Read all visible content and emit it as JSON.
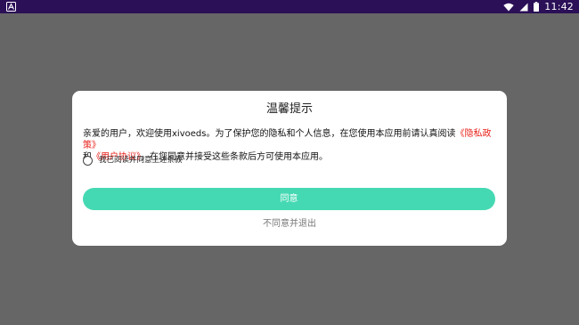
{
  "status_bar": {
    "time": "11:42",
    "left_icon": "android-debug-icon",
    "right_icons": [
      "wifi-icon",
      "signal-icon",
      "battery-icon"
    ],
    "background": "#2b0f57"
  },
  "dialog": {
    "title": "温馨提示",
    "body": {
      "part1": "亲爱的用户，欢迎使用xivoeds。为了保护您的隐私和个人信息，在您使用本应用前请认真阅读",
      "privacy_link": "《隐私政策》",
      "part2": "和",
      "terms_link": "《用户协议》",
      "part3": "，在您同意并接受这些条款后方可使用本应用。"
    },
    "agree_checkbox_label": "我已阅读并同意上述条款",
    "agree_checkbox_checked": false,
    "agree_button": "同意",
    "decline_link": "不同意并退出"
  },
  "colors": {
    "backdrop": "#666666",
    "accent": "#45d9b3",
    "link": "#e8221b"
  }
}
